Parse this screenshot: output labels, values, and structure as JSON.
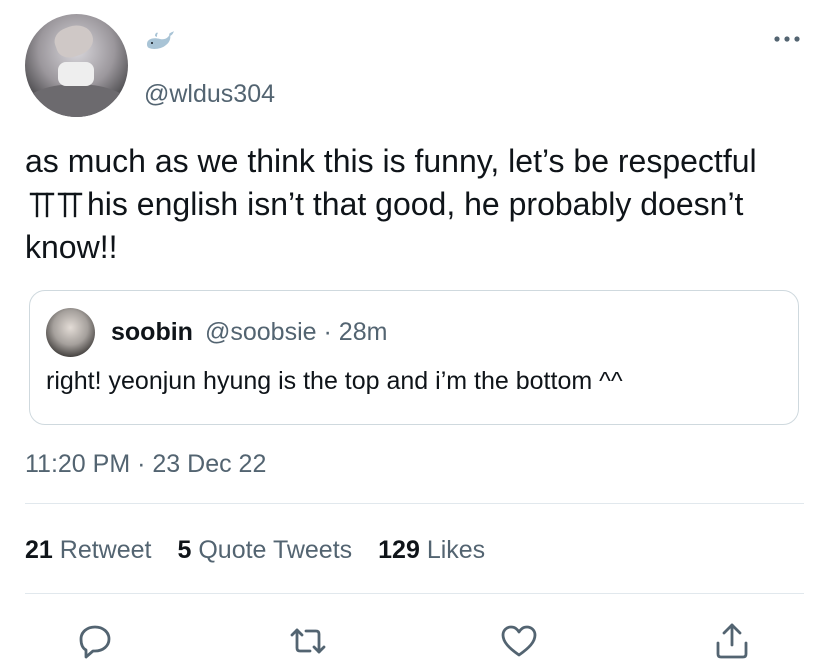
{
  "author": {
    "handle": "@wldus304",
    "display_name_icon": "whale-icon",
    "avatar": "avatar-photo"
  },
  "more_icon": "more-dots-icon",
  "tweet": {
    "text_part1": "as much as we think this is funny, let’s be respectful",
    "text_glyph": "ㅠㅠ",
    "text_part2": "his english isn’t that good, he probably doesn’t know!!"
  },
  "quote": {
    "name": "soobin",
    "handle": "@soobsie",
    "separator": "·",
    "time": "28m",
    "text": "right! yeonjun hyung is the top and i’m the bottom ^^"
  },
  "timestamp": {
    "time": "11:20 PM",
    "separator": "·",
    "date": "23 Dec 22"
  },
  "stats": {
    "retweets_count": "21",
    "retweets_label": "Retweet",
    "quotes_count": "5",
    "quotes_label": "Quote Tweets",
    "likes_count": "129",
    "likes_label": "Likes"
  },
  "actions": [
    "reply-icon",
    "retweet-icon",
    "like-icon",
    "share-icon"
  ],
  "colors": {
    "text": "#0f1419",
    "secondary": "#536471",
    "border": "#cfd9de",
    "divider": "#e1e8ed"
  }
}
